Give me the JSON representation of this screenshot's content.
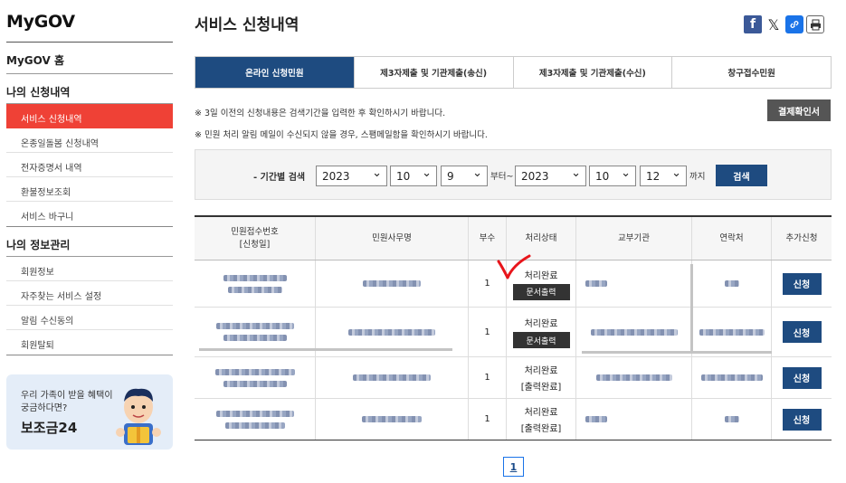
{
  "sidebar": {
    "brand": "MyGOV",
    "home": "MyGOV 홈",
    "section1": {
      "title": "나의 신청내역",
      "items": [
        "서비스 신청내역",
        "온종일돌봄 신청내역",
        "전자증명서 내역",
        "환불정보조회",
        "서비스 바구니"
      ]
    },
    "section2": {
      "title": "나의 정보관리",
      "items": [
        "회원정보",
        "자주찾는 서비스 설정",
        "알림 수신동의",
        "회원탈퇴"
      ]
    },
    "banner": {
      "line1": "우리 가족이 받을 혜택이 궁금하다면?",
      "line2": "보조금24"
    }
  },
  "main": {
    "title": "서비스 신청내역",
    "share": {
      "facebook": "f",
      "x": "𝕏",
      "link": "🔗",
      "print": "🖶"
    },
    "tabs": [
      "온라인 신청민원",
      "제3자제출 및 기관제출(송신)",
      "제3자제출 및 기관제출(수신)",
      "창구접수민원"
    ],
    "notice1": "※ 3일 이전의 신청내용은 검색기간을 입력한 후 확인하시기 바랍니다.",
    "notice2": "※ 민원 처리 알림 메일이 수신되지 않을 경우, 스팸메일함을 확인하시기 바랍니다.",
    "receipt_button": "결제확인서",
    "search": {
      "label": "- 기간별 검색",
      "from_year": "2023",
      "from_month": "10",
      "from_day": "9",
      "from_text": "부터~",
      "to_year": "2023",
      "to_month": "10",
      "to_day": "12",
      "to_text": "까지",
      "button": "검색"
    },
    "table": {
      "headers": [
        "민원접수번호\n[신청일]",
        "민원사무명",
        "부수",
        "처리상태",
        "교부기관",
        "연락처",
        "추가신청"
      ],
      "rows": [
        {
          "copies": "1",
          "status": "처리완료",
          "doc": "문서출력",
          "apply": "신청"
        },
        {
          "copies": "1",
          "status": "처리완료",
          "doc": "문서출력",
          "apply": "신청"
        },
        {
          "copies": "1",
          "status": "처리완료",
          "doc_text": "[출력완료]",
          "apply": "신청"
        },
        {
          "copies": "1",
          "status": "처리완료",
          "doc_text": "[출력완료]",
          "apply": "신청"
        }
      ]
    },
    "pagination": {
      "current": "1"
    }
  },
  "colors": {
    "accent_red": "#ef4136",
    "navy": "#1e4b80",
    "dark_gray": "#333333",
    "check_red": "#e8151b"
  }
}
